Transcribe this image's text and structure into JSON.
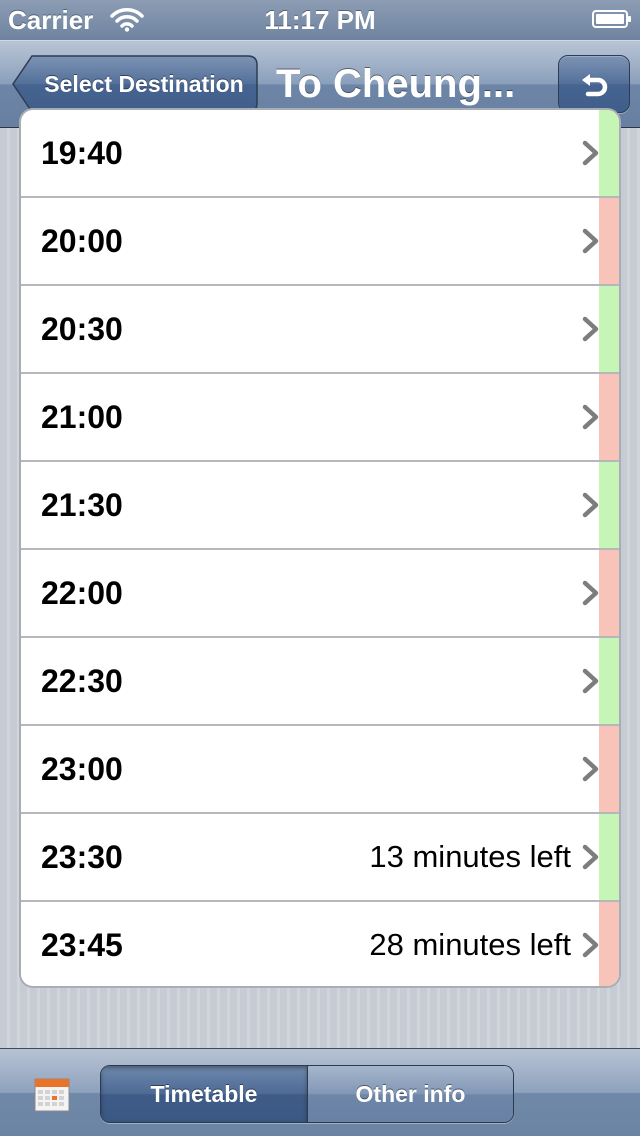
{
  "status_bar": {
    "carrier": "Carrier",
    "time": "11:17 PM",
    "wifi_icon": "wifi-icon",
    "battery_icon": "battery-icon"
  },
  "nav": {
    "back_label": "Select Destination",
    "title": "To Cheung...",
    "refresh_icon": "refresh-icon"
  },
  "indicator_colors": {
    "green": "#c7f5b5",
    "red": "#f8c3b9"
  },
  "departures": [
    {
      "time": "19:40",
      "note": "",
      "indicator": "green"
    },
    {
      "time": "20:00",
      "note": "",
      "indicator": "red"
    },
    {
      "time": "20:30",
      "note": "",
      "indicator": "green"
    },
    {
      "time": "21:00",
      "note": "",
      "indicator": "red"
    },
    {
      "time": "21:30",
      "note": "",
      "indicator": "green"
    },
    {
      "time": "22:00",
      "note": "",
      "indicator": "red"
    },
    {
      "time": "22:30",
      "note": "",
      "indicator": "green"
    },
    {
      "time": "23:00",
      "note": "",
      "indicator": "red"
    },
    {
      "time": "23:30",
      "note": "13 minutes left",
      "indicator": "green"
    },
    {
      "time": "23:45",
      "note": "28 minutes left",
      "indicator": "red"
    }
  ],
  "toolbar": {
    "calendar_icon": "calendar-icon",
    "segments": [
      {
        "label": "Timetable",
        "selected": true
      },
      {
        "label": "Other info",
        "selected": false
      }
    ]
  }
}
